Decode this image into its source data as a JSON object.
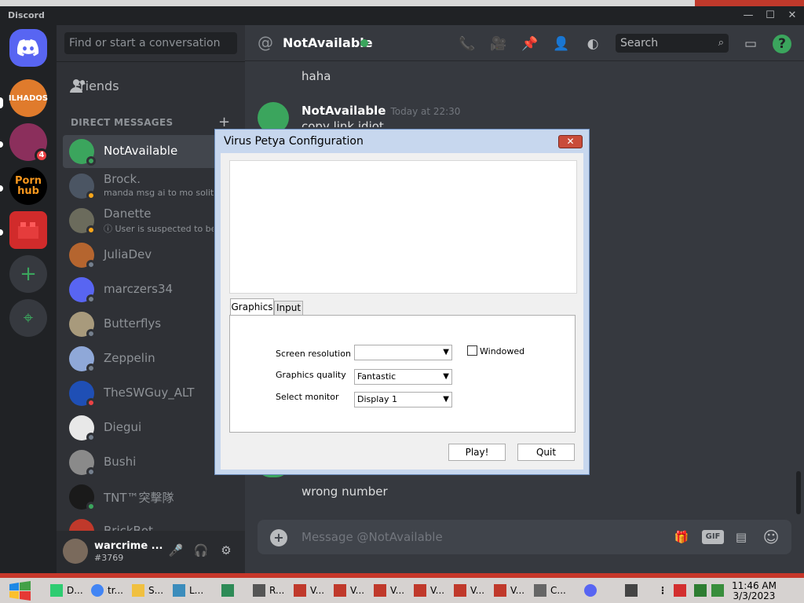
{
  "window": {
    "app_name": "Discord",
    "min": "—",
    "max": "☐",
    "close": "✕"
  },
  "servers": [
    {
      "name": "home",
      "label": "",
      "color": "#5865f2"
    },
    {
      "name": "ilhados",
      "label": "ILHADOS",
      "color": "#e07b2c"
    },
    {
      "name": "girl",
      "label": "",
      "color": "#8b2f5c",
      "badge": "4"
    },
    {
      "name": "hub",
      "label": "Porn hub",
      "color": "#000000"
    },
    {
      "name": "lego",
      "label": "",
      "color": "#d12b2b"
    }
  ],
  "rail": {
    "add_label": "+",
    "explore_label": "⌖"
  },
  "dm": {
    "search_placeholder": "Find or start a conversation",
    "friends_label": "Friends",
    "header": "DIRECT MESSAGES",
    "add": "+",
    "items": [
      {
        "name": "NotAvailable",
        "sub": "",
        "color": "#3ba55d",
        "status": "#3ba55d"
      },
      {
        "name": "Brock.",
        "sub": "manda msg ai to mo solitar",
        "color": "#4b5563",
        "status": "#faa61a"
      },
      {
        "name": "Danette",
        "sub": "ⓘ User is suspected to be p",
        "color": "#6b6b5c",
        "status": "#faa61a"
      },
      {
        "name": "JuliaDev",
        "sub": "",
        "color": "#b5652f",
        "status": "#747f8d"
      },
      {
        "name": "marczers34",
        "sub": "",
        "color": "#5865f2",
        "status": "#747f8d"
      },
      {
        "name": "Butterflys",
        "sub": "",
        "color": "#a89a7c",
        "status": "#747f8d"
      },
      {
        "name": "Zeppelin",
        "sub": "",
        "color": "#8fa8d8",
        "status": "#747f8d"
      },
      {
        "name": "TheSWGuy_ALT",
        "sub": "",
        "color": "#1f4fb5",
        "status": "#ed4245"
      },
      {
        "name": "Diegui",
        "sub": "",
        "color": "#e8e8e8",
        "status": "#747f8d"
      },
      {
        "name": "Bushi",
        "sub": "",
        "color": "#8a8a8a",
        "status": "#747f8d"
      },
      {
        "name": "TNT™突擊隊",
        "sub": "",
        "color": "#1a1a1a",
        "status": "#3ba55d"
      },
      {
        "name": "BrickBot",
        "sub": "",
        "color": "#c0392b",
        "status": "#747f8d"
      }
    ]
  },
  "user": {
    "name": "warcrime ...",
    "tag": "#3769",
    "mic": "🎤",
    "headset": "🎧",
    "settings": "⚙"
  },
  "chat": {
    "at": "@",
    "title": "NotAvailable",
    "search_placeholder": "Search",
    "messages": {
      "top": "haha",
      "author": "NotAvailable",
      "timestamp": "Today at 22:30",
      "line": "copy link idiot",
      "bottom": "wrong number"
    },
    "compose_placeholder": "Message @NotAvailable",
    "icons": {
      "call": "📞",
      "video": "🎥",
      "pin": "📌",
      "add_member": "👤",
      "profile": "◐",
      "inbox": "▭",
      "help": "?",
      "gift": "🎁",
      "gif": "GIF",
      "sticker": "▤",
      "emoji": "☺"
    }
  },
  "dialog": {
    "title": "Virus Petya Configuration",
    "close": "✕",
    "tabs": [
      "Graphics",
      "Input"
    ],
    "labels": {
      "resolution": "Screen resolution",
      "quality": "Graphics quality",
      "monitor": "Select monitor",
      "windowed": "Windowed"
    },
    "values": {
      "resolution": "",
      "quality": "Fantastic",
      "monitor": "Display 1"
    },
    "arrow": "▼",
    "buttons": {
      "play": "Play!",
      "quit": "Quit"
    }
  },
  "taskbar": {
    "items": [
      {
        "label": "D...",
        "color": "#2ecc71"
      },
      {
        "label": "tr...",
        "color": "#4285f4"
      },
      {
        "label": "S...",
        "color": "#f0c040"
      },
      {
        "label": "L...",
        "color": "#3c8dbc"
      },
      {
        "label": "",
        "color": "#2e8b57"
      },
      {
        "label": "R...",
        "color": "#555555"
      },
      {
        "label": "V...",
        "color": "#c0392b"
      },
      {
        "label": "V...",
        "color": "#c0392b"
      },
      {
        "label": "V...",
        "color": "#c0392b"
      },
      {
        "label": "V...",
        "color": "#c0392b"
      },
      {
        "label": "V...",
        "color": "#c0392b"
      },
      {
        "label": "V...",
        "color": "#c0392b"
      },
      {
        "label": "C...",
        "color": "#666666"
      },
      {
        "label": "",
        "color": "#5865f2"
      }
    ],
    "time": "11:46 AM",
    "date": "3/3/2023"
  }
}
